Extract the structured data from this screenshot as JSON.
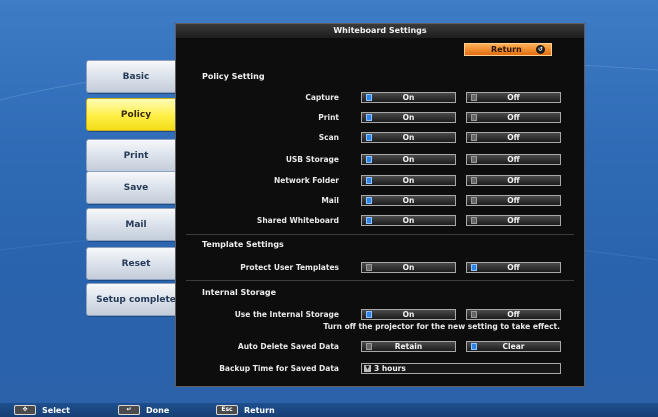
{
  "panel": {
    "title": "Whiteboard Settings",
    "return_label": "Return"
  },
  "sidebar": {
    "items": [
      {
        "label": "Basic"
      },
      {
        "label": "Policy",
        "active": true
      },
      {
        "label": "Print"
      },
      {
        "label": "Save"
      },
      {
        "label": "Mail"
      },
      {
        "label": "Reset"
      },
      {
        "label": "Setup complete"
      }
    ]
  },
  "policy_setting": {
    "title": "Policy Setting",
    "rows": [
      {
        "label": "Capture",
        "options": [
          "On",
          "Off"
        ],
        "selected": "On"
      },
      {
        "label": "Print",
        "options": [
          "On",
          "Off"
        ],
        "selected": "On"
      },
      {
        "label": "Scan",
        "options": [
          "On",
          "Off"
        ],
        "selected": "On"
      },
      {
        "label": "USB Storage",
        "options": [
          "On",
          "Off"
        ],
        "selected": "On"
      },
      {
        "label": "Network Folder",
        "options": [
          "On",
          "Off"
        ],
        "selected": "On"
      },
      {
        "label": "Mail",
        "options": [
          "On",
          "Off"
        ],
        "selected": "On"
      },
      {
        "label": "Shared Whiteboard",
        "options": [
          "On",
          "Off"
        ],
        "selected": "On"
      }
    ]
  },
  "template_settings": {
    "title": "Template Settings",
    "rows": [
      {
        "label": "Protect User Templates",
        "options": [
          "On",
          "Off"
        ],
        "selected": "Off"
      }
    ]
  },
  "internal_storage": {
    "title": "Internal Storage",
    "use_internal": {
      "label": "Use the Internal Storage",
      "options": [
        "On",
        "Off"
      ],
      "selected": "On"
    },
    "note": "Turn off the projector for the new setting to take effect.",
    "auto_delete": {
      "label": "Auto Delete Saved Data",
      "options": [
        "Retain",
        "Clear"
      ],
      "selected": "Clear"
    },
    "backup_time": {
      "label": "Backup Time for Saved Data",
      "value": "3 hours"
    }
  },
  "help_bar": {
    "select": "Select",
    "done": "Done",
    "return": "Return"
  },
  "colors": {
    "accent_orange": "#e26d11",
    "active_yellow": "#ffef46",
    "selected_blue": "#2f84e6"
  }
}
